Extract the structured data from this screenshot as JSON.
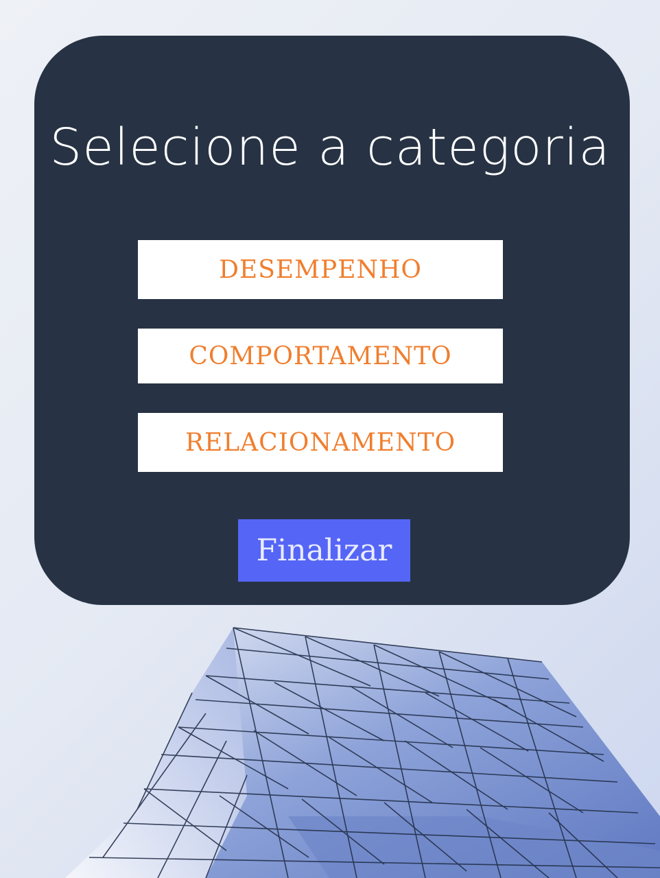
{
  "screen": {
    "title": "Selecione a categoria"
  },
  "categories": [
    {
      "label": "DESEMPENHO"
    },
    {
      "label": "COMPORTAMENTO"
    },
    {
      "label": "RELACIONAMENTO"
    }
  ],
  "actions": {
    "finish_label": "Finalizar"
  },
  "colors": {
    "panel": "#273344",
    "category_text": "#f07e2e",
    "category_background": "#ffffff",
    "finish_button": "#5565f5",
    "facade": "#7089cc"
  },
  "background": {
    "image": "glass-facade-building"
  }
}
